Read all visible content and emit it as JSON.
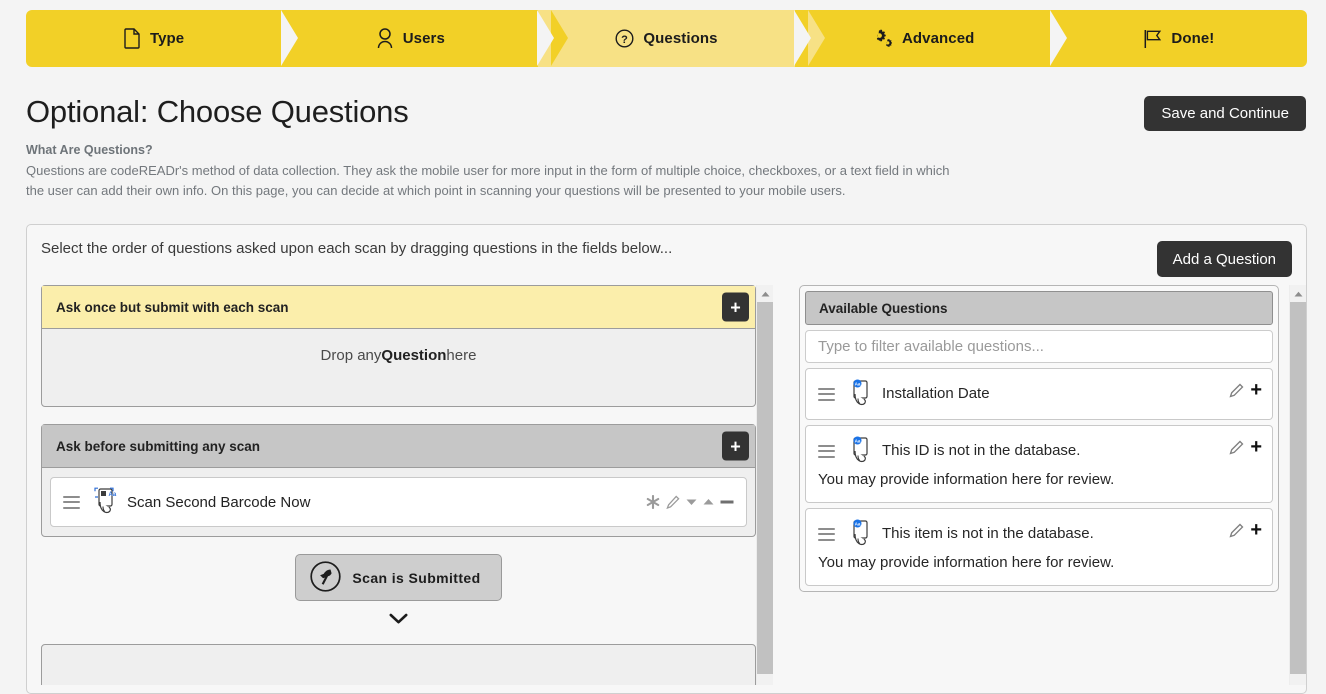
{
  "wizard": {
    "steps": [
      {
        "label": "Type",
        "icon": "file-icon",
        "active": false
      },
      {
        "label": "Users",
        "icon": "user-icon",
        "active": false
      },
      {
        "label": "Questions",
        "icon": "question-circle-icon",
        "active": true
      },
      {
        "label": "Advanced",
        "icon": "gears-icon",
        "active": false
      },
      {
        "label": "Done!",
        "icon": "flag-icon",
        "active": false
      }
    ],
    "colors": {
      "inactive": "#F2D027",
      "active": "#F7E185"
    }
  },
  "header": {
    "title": "Optional: Choose Questions",
    "save_button": "Save and Continue",
    "blurb_heading": "What Are Questions?",
    "blurb_body": "Questions are codeREADr's method of data collection. They ask the mobile user for more input in the form of multiple choice, checkboxes, or a text field in which the user can add their own info. On this page, you can decide at which point in scanning your questions will be presented to your mobile users."
  },
  "card": {
    "instruction": "Select the order of questions asked upon each scan by dragging questions in the fields below...",
    "add_question_button": "Add a Question"
  },
  "left_panel": {
    "zones": [
      {
        "title": "Ask once but submit with each scan",
        "style": "yellow",
        "add_label": "+",
        "empty_prefix": "Drop any ",
        "empty_bold": "Question",
        "empty_suffix": " here",
        "items": []
      },
      {
        "title": "Ask before submitting any scan",
        "style": "grey",
        "add_label": "+",
        "items": [
          {
            "label": "Scan Second Barcode Now",
            "icon": "phone-scan-icon",
            "actions": [
              "asterisk-icon",
              "pencil-icon",
              "caret-down-icon",
              "caret-up-icon",
              "minus-icon"
            ]
          }
        ]
      }
    ],
    "submitted_button": {
      "label": "Scan is Submitted",
      "icon": "barcode-scanner-icon"
    },
    "chevron": "chevron-down-icon"
  },
  "right_panel": {
    "heading": "Available Questions",
    "filter_placeholder": "Type to filter available questions...",
    "items": [
      {
        "first_line": "Installation Date",
        "rest": "",
        "icon": "phone-text-question-icon",
        "actions": [
          "pencil-icon",
          "plus-icon"
        ]
      },
      {
        "first_line": "This ID is not in the database.",
        "rest": "You may provide information here for review.",
        "icon": "phone-text-question-icon",
        "actions": [
          "pencil-icon",
          "plus-icon"
        ]
      },
      {
        "first_line": "This item is not in the database.",
        "rest": "You may provide information here for review.",
        "icon": "phone-text-question-icon",
        "actions": [
          "pencil-icon",
          "plus-icon"
        ]
      }
    ]
  },
  "scrollbars": {
    "left": {
      "arrow": "caret-up-icon"
    },
    "right": {
      "arrow": "caret-up-icon"
    }
  }
}
